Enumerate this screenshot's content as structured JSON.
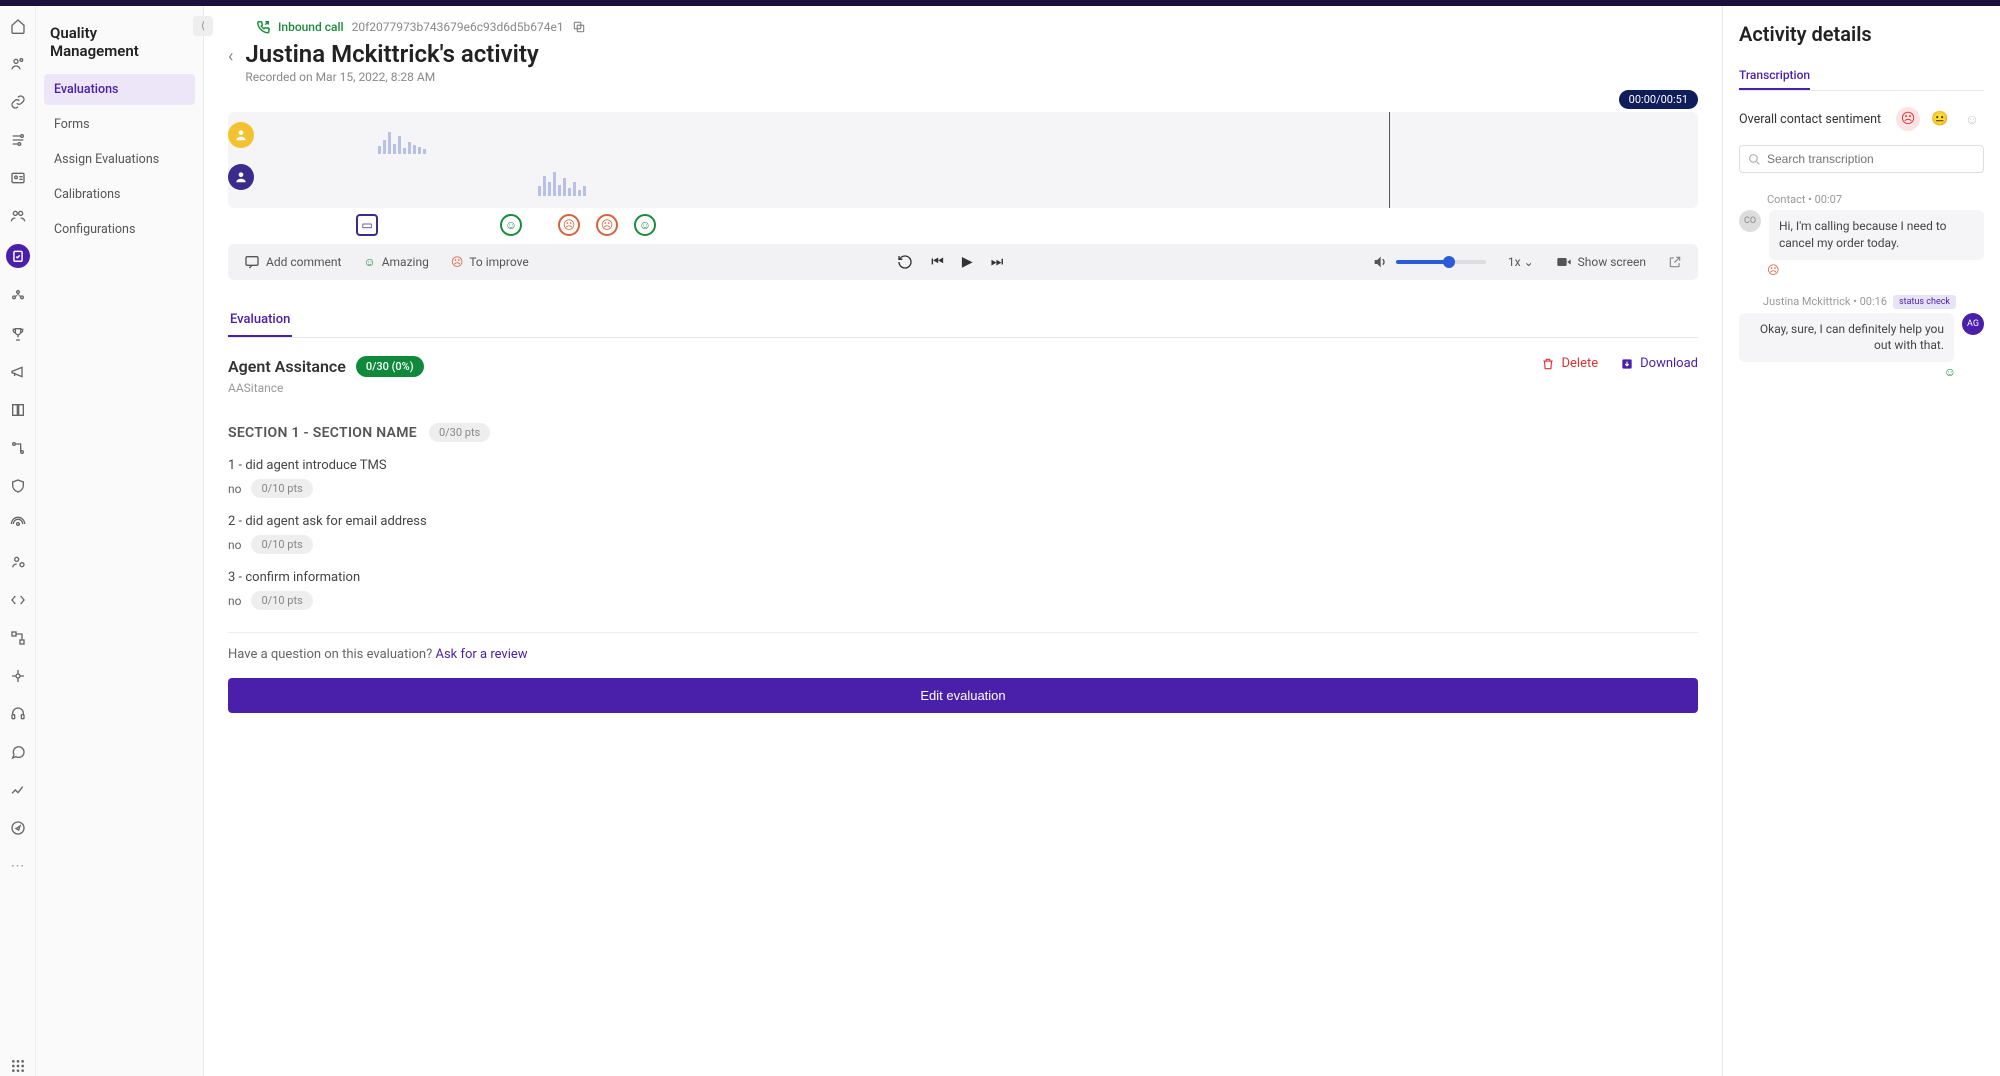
{
  "sidebar": {
    "title": "Quality Management",
    "items": [
      "Evaluations",
      "Forms",
      "Assign Evaluations",
      "Calibrations",
      "Configurations"
    ],
    "activeIndex": 0
  },
  "header": {
    "callType": "Inbound call",
    "callId": "20f2077973b743679e6c93d6d5b674e1",
    "title": "Justina Mckittrick's activity",
    "recorded": "Recorded on Mar 15, 2022, 8:28 AM"
  },
  "player": {
    "time": "00:00/00:51",
    "addComment": "Add comment",
    "amazing": "Amazing",
    "toImprove": "To improve",
    "speed": "1x",
    "showScreen": "Show screen"
  },
  "tabs": {
    "evaluation": "Evaluation"
  },
  "evaluation": {
    "title": "Agent Assitance",
    "badge": "0/30 (0%)",
    "sub": "AASitance",
    "delete": "Delete",
    "download": "Download",
    "section": {
      "title": "SECTION 1 - SECTION NAME",
      "pts": "0/30 pts",
      "questions": [
        {
          "text": "1 - did agent introduce TMS",
          "answer": "no",
          "pts": "0/10 pts"
        },
        {
          "text": "2 - did agent ask for email address",
          "answer": "no",
          "pts": "0/10 pts"
        },
        {
          "text": "3 - confirm information",
          "answer": "no",
          "pts": "0/10 pts"
        }
      ]
    },
    "reviewPrompt": "Have a question on this evaluation? ",
    "reviewLink": "Ask for a review",
    "editBtn": "Edit evaluation"
  },
  "panel": {
    "title": "Activity details",
    "tab": "Transcription",
    "sentimentLabel": "Overall contact sentiment",
    "searchPlaceholder": "Search transcription",
    "messages": [
      {
        "role": "contact",
        "speaker": "Contact",
        "time": "00:07",
        "text": "Hi, I'm calling because I need to cancel my order today.",
        "sentiment": "neg",
        "avatar": "CO",
        "tag": ""
      },
      {
        "role": "agent",
        "speaker": "Justina Mckittrick",
        "time": "00:16",
        "text": "Okay, sure, I can definitely help you out with that.",
        "sentiment": "pos",
        "avatar": "AG",
        "tag": "status check"
      }
    ]
  }
}
